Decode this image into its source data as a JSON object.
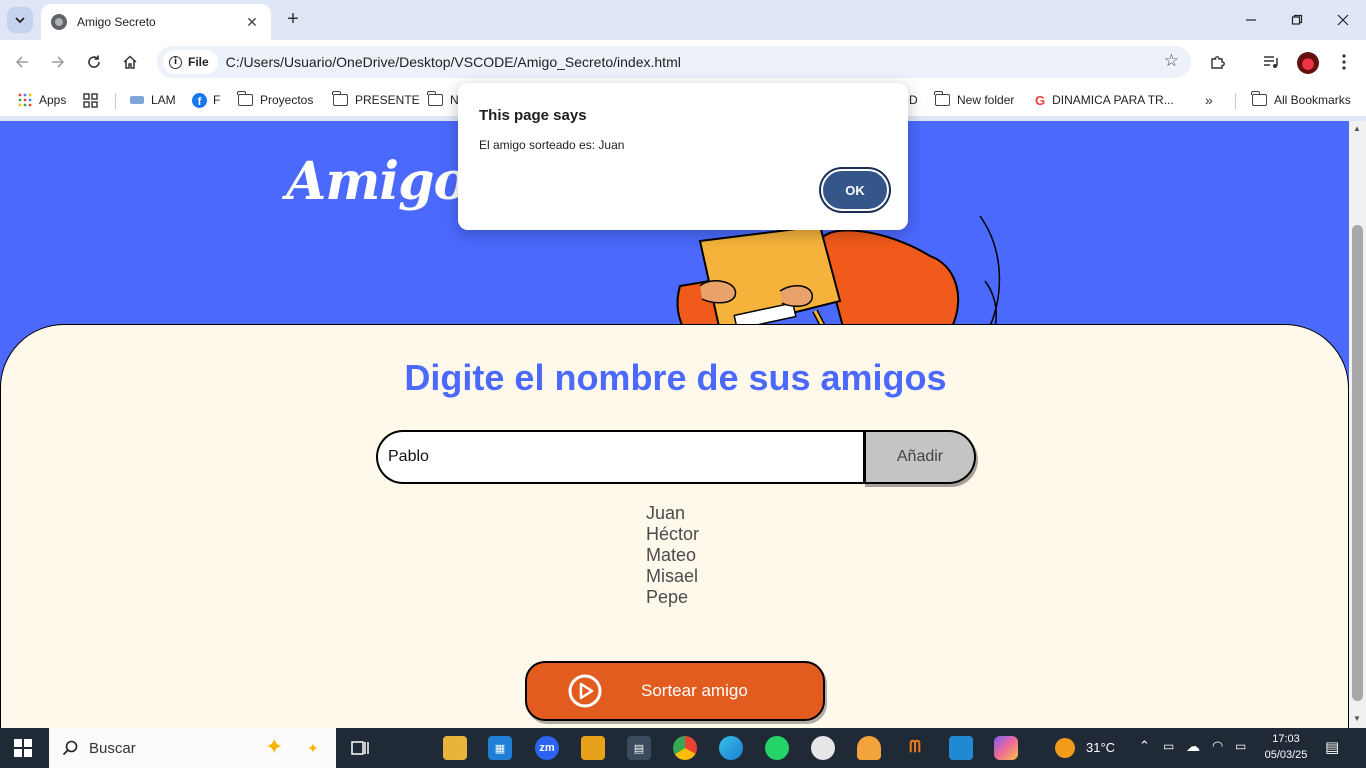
{
  "browser": {
    "tab_title": "Amigo Secreto",
    "file_chip": "File",
    "url": "C:/Users/Usuario/OneDrive/Desktop/VSCODE/Amigo_Secreto/index.html",
    "bookmarks": {
      "apps": "Apps",
      "lam": "LAM",
      "f": "F",
      "proyectos": "Proyectos",
      "presente": "PRESENTE",
      "n": "N",
      "d": "D",
      "new_folder": "New folder",
      "dinamica": "DINAMICA PARA TR...",
      "all_bookmarks": "All Bookmarks"
    }
  },
  "page": {
    "hero_title": "Amigo S",
    "section_title": "Digite el nombre de sus amigos",
    "input_value": "Pablo",
    "add_button": "Añadir",
    "friends": [
      "Juan",
      "Héctor",
      "Mateo",
      "Misael",
      "Pepe"
    ],
    "draw_button": "Sortear amigo"
  },
  "dialog": {
    "title": "This page says",
    "message": "El amigo sorteado es: Juan",
    "ok": "OK"
  },
  "taskbar": {
    "search": "Buscar",
    "weather": "31°C",
    "time": "17:03",
    "date": "05/03/25",
    "zoom_label": "zm"
  },
  "colors": {
    "page_blue": "#4b69fd",
    "panel_cream": "#fff9eb",
    "draw_orange": "#e25b1f",
    "dialog_button": "#355689"
  }
}
